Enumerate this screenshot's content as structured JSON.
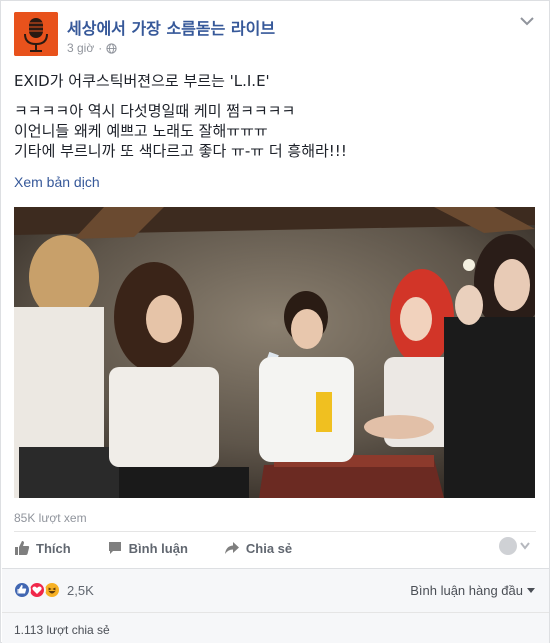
{
  "header": {
    "page_name": "세상에서 가장 소름돋는 라이브",
    "timestamp": "3 giờ",
    "audience_icon": "globe-icon",
    "menu_icon": "chevron-down-icon"
  },
  "post": {
    "title_line": "EXID가 어쿠스틱버젼으로 부르는 'L.I.E'",
    "lines": [
      "ㅋㅋㅋㅋ아 역시 다섯명일때 케미 쩜ㅋㅋㅋㅋ",
      "이언니들 왜케 예쁘고 노래도 잘해ㅠㅠㅠ",
      "기타에 부르니까 또 색다르고 좋다 ㅠ-ㅠ 더 흥해라!!!"
    ],
    "translate_link": "Xem bản dịch"
  },
  "video": {
    "views": "85K lượt xem"
  },
  "actions": {
    "like": "Thích",
    "comment": "Bình luận",
    "share": "Chia sẻ"
  },
  "footer": {
    "reaction_count": "2,5K",
    "comment_order": "Bình luận hàng đầu",
    "shares": "1.113 lượt chia sẻ"
  },
  "colors": {
    "link": "#365899",
    "avatar": "#e8521c",
    "like": "#4267b2",
    "love": "#f0284a",
    "haha": "#f7b125"
  }
}
